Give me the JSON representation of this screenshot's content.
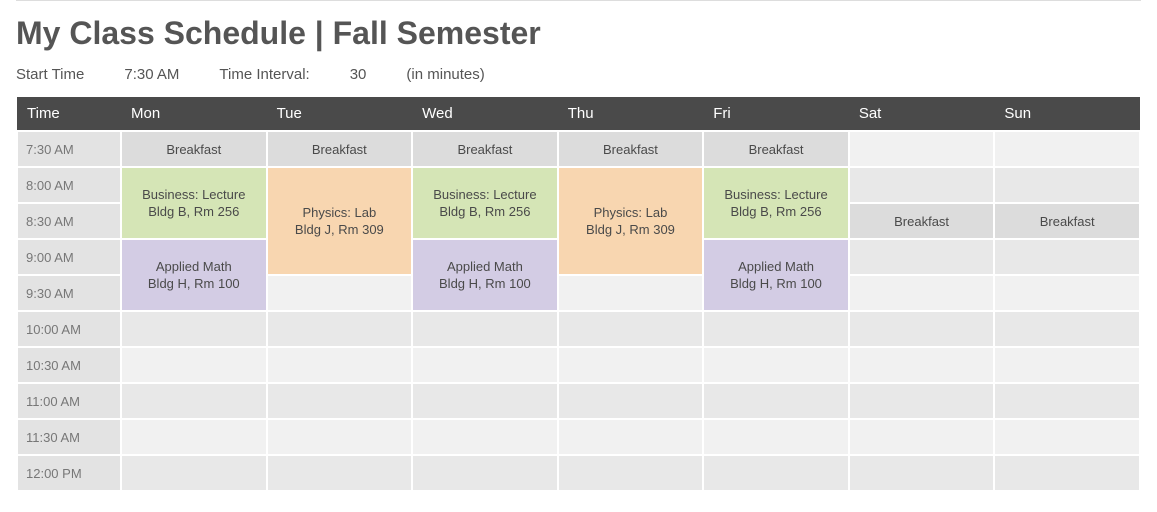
{
  "title": "My Class Schedule | Fall Semester",
  "controls": {
    "start_time_label": "Start Time",
    "start_time_value": "7:30 AM",
    "interval_label": "Time Interval:",
    "interval_value": "30",
    "interval_units": "(in minutes)"
  },
  "header": {
    "time": "Time",
    "days": [
      "Mon",
      "Tue",
      "Wed",
      "Thu",
      "Fri",
      "Sat",
      "Sun"
    ]
  },
  "times": [
    "7:30 AM",
    "8:00 AM",
    "8:30 AM",
    "9:00 AM",
    "9:30 AM",
    "10:00 AM",
    "10:30 AM",
    "11:00 AM",
    "11:30 AM",
    "12:00 PM"
  ],
  "events": {
    "breakfast": {
      "name": "Breakfast",
      "loc": ""
    },
    "business": {
      "name": "Business: Lecture",
      "loc": "Bldg B, Rm 256"
    },
    "physics": {
      "name": "Physics: Lab",
      "loc": "Bldg J, Rm 309"
    },
    "math": {
      "name": "Applied Math",
      "loc": "Bldg H, Rm 100"
    }
  }
}
